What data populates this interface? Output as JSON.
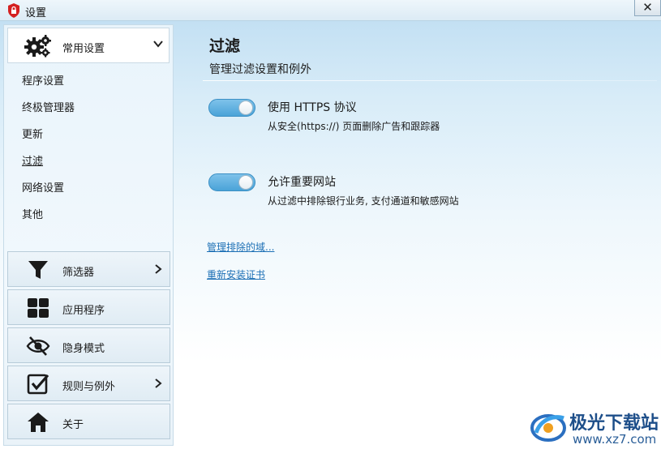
{
  "window": {
    "title": "设置",
    "close_label": "✕"
  },
  "sidebar": {
    "group": {
      "label": "常用设置",
      "icon": "gears-icon"
    },
    "sub_items": [
      {
        "label": "程序设置",
        "active": false
      },
      {
        "label": "终极管理器",
        "active": false
      },
      {
        "label": "更新",
        "active": false
      },
      {
        "label": "过滤",
        "active": true
      },
      {
        "label": "网络设置",
        "active": false
      },
      {
        "label": "其他",
        "active": false
      }
    ],
    "nav": [
      {
        "label": "筛选器",
        "icon": "funnel-icon",
        "has_arrow": true
      },
      {
        "label": "应用程序",
        "icon": "grid-icon",
        "has_arrow": false
      },
      {
        "label": "隐身模式",
        "icon": "eye-slash-icon",
        "has_arrow": false
      },
      {
        "label": "规则与例外",
        "icon": "checkbox-icon",
        "has_arrow": true
      },
      {
        "label": "关于",
        "icon": "home-icon",
        "has_arrow": false
      }
    ]
  },
  "main": {
    "title": "过滤",
    "subtitle": "管理过滤设置和例外",
    "options": [
      {
        "title": "使用 HTTPS 协议",
        "description": "从安全(https://) 页面删除广告和跟踪器",
        "enabled": true
      },
      {
        "title": "允许重要网站",
        "description": "从过滤中排除银行业务, 支付通道和敏感网站",
        "enabled": true
      }
    ],
    "links": [
      {
        "label": "管理排除的域..."
      },
      {
        "label": "重新安装证书"
      }
    ]
  },
  "watermark": {
    "line1": "极光下载站",
    "line2": "www.xz7.com"
  },
  "colors": {
    "toggle_on": "#4aa3d8",
    "link": "#1c6fb5",
    "watermark": "#1e4f8a"
  }
}
